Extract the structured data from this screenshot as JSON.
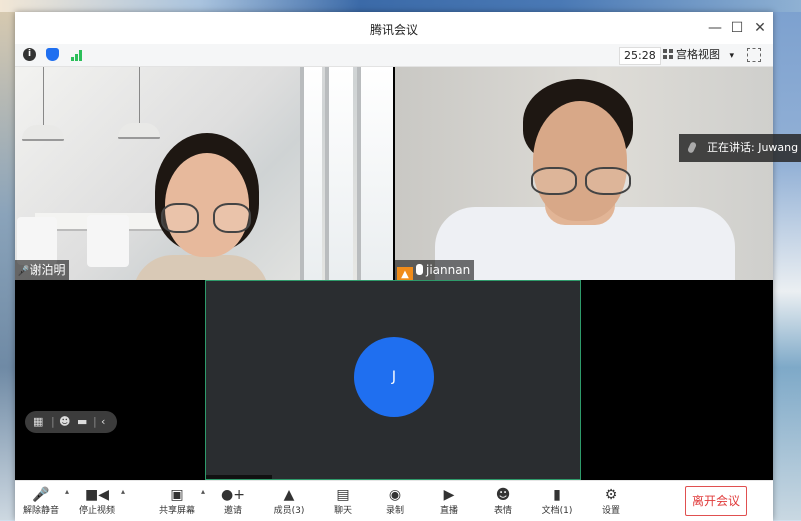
{
  "window": {
    "title": "腾讯会议"
  },
  "window_controls": {
    "minimize": "—",
    "maximize": "☐",
    "close": "✕"
  },
  "status_bar": {
    "info_icon": "i",
    "shield_icon": "shield",
    "signal_icon": "signal",
    "timer": "25:28",
    "view_mode": "宫格视图",
    "view_caret": "▾"
  },
  "participants": [
    {
      "name": "谢泊明"
    },
    {
      "name": "jiannan"
    },
    {
      "name": "J"
    }
  ],
  "speaking_banner": {
    "text": "正在讲话: Juwang ; j"
  },
  "float_bar": {
    "back": "‹"
  },
  "toolbar": {
    "mute": "解除静音",
    "video": "停止视频",
    "share": "共享屏幕",
    "invite": "邀请",
    "members": "成员(3)",
    "chat": "聊天",
    "record": "录制",
    "live": "直播",
    "emoji": "表情",
    "docs": "文档(1)",
    "settings": "设置",
    "leave": "离开会议",
    "caret": "▴"
  },
  "colors": {
    "accent_blue": "#1f6ff0",
    "leave_red": "#e03a3a",
    "signal_green": "#2cbf5a",
    "host_orange": "#f08c1a"
  }
}
